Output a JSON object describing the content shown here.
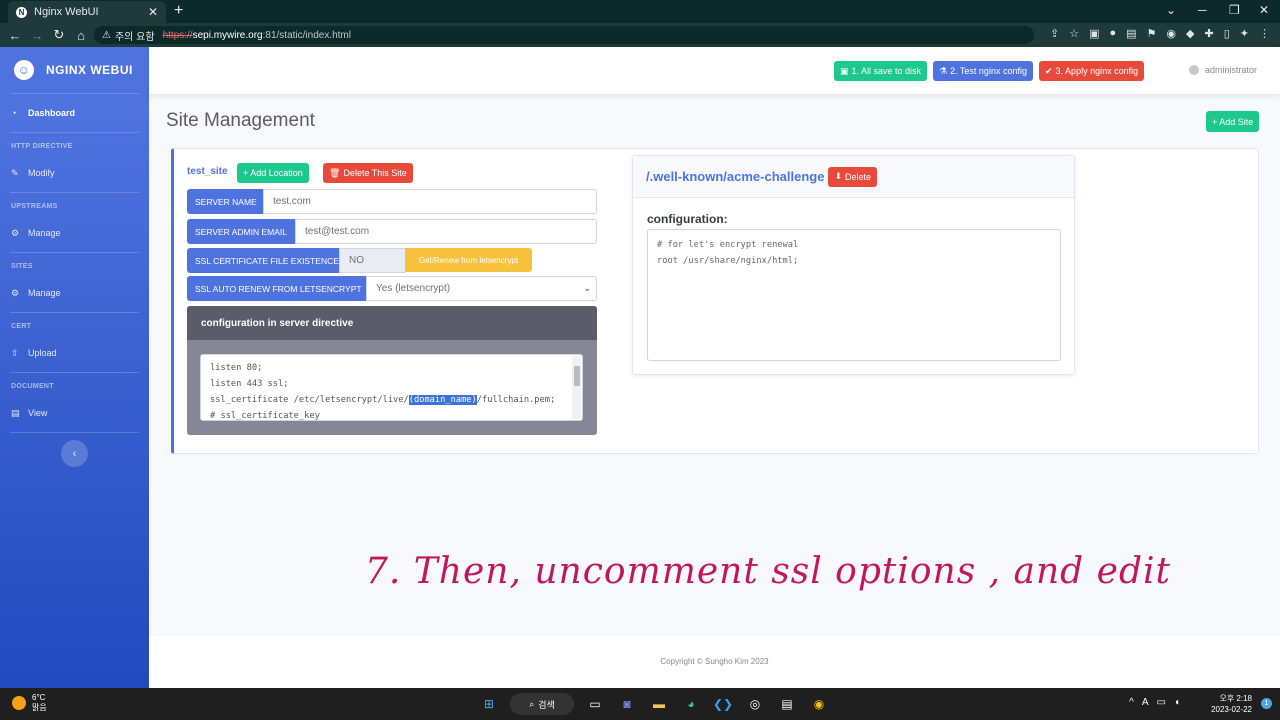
{
  "browser": {
    "tab_title": "Nginx WebUI",
    "address_warning": "주의 요함",
    "url_scheme": "https://",
    "url_host": "sepi.mywire.org",
    "url_rest": ":81/static/index.html"
  },
  "sidebar": {
    "brand": "NGINX WEBUI",
    "dashboard": "Dashboard",
    "sections": [
      {
        "heading": "HTTP DIRECTIVE",
        "item": "Modify"
      },
      {
        "heading": "UPSTREAMS",
        "item": "Manage"
      },
      {
        "heading": "SITES",
        "item": "Manage"
      },
      {
        "heading": "CERT",
        "item": "Upload"
      },
      {
        "heading": "DOCUMENT",
        "item": "View"
      }
    ]
  },
  "topbar": {
    "save_btn": "1. All save to disk",
    "test_btn": "2. Test nginx config",
    "apply_btn": "3. Apply nginx config",
    "user": "administrator"
  },
  "main": {
    "title": "Site Management",
    "add_site": "+ Add Site",
    "site": {
      "name": "test_site",
      "add_location": "+ Add Location",
      "delete_site": "Delete This Site",
      "server_name_label": "SERVER NAME",
      "server_name_value": "test.com",
      "admin_email_label": "SERVER ADMIN EMAIL",
      "admin_email_value": "test@test.com",
      "ssl_exist_label": "SSL CERTIFICATE FILE EXISTENCE",
      "ssl_exist_value": "NO",
      "renew_btn": "Get/Renew from letsencrypt",
      "auto_renew_label": "SSL AUTO RENEW FROM LETSENCRYPT",
      "auto_renew_value": "Yes (letsencrypt)",
      "directive_title": "configuration in server directive",
      "code_lines": [
        "listen 80;",
        "listen 443 ssl;",
        "# ssl_certificate_key"
      ],
      "ssl_cert_prefix": "ssl_certificate /etc/letsencrypt/live/",
      "ssl_cert_selected": "(domain_name)",
      "ssl_cert_suffix": "/fullchain.pem;"
    },
    "location": {
      "path": "/.well-known/acme-challenge",
      "delete": "Delete",
      "config_label": "configuration:",
      "config_lines": [
        "# for let's encrypt renewal",
        "root /usr/share/nginx/html;"
      ]
    }
  },
  "footer": "Copyright © Sungho Kim 2023",
  "annotation": "7. Then, uncomment ssl options , and edit",
  "taskbar": {
    "temp": "6°C",
    "weather": "맑음",
    "search": "검색",
    "time": "오후 2:18",
    "date": "2023-02-22",
    "notif_count": "1"
  }
}
